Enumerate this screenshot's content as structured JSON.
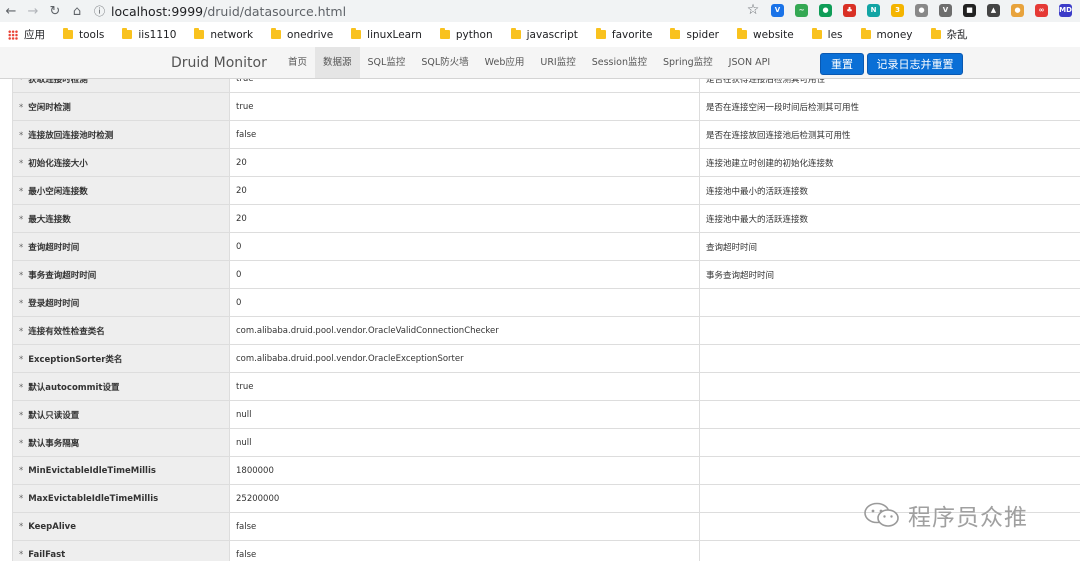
{
  "browser": {
    "url_host": "localhost:9999",
    "url_path": "/druid/datasource.html",
    "bookmarks": [
      "应用",
      "tools",
      "iis1110",
      "network",
      "onedrive",
      "linuxLearn",
      "python",
      "javascript",
      "favorite",
      "spider",
      "website",
      "les",
      "money",
      "杂乱"
    ],
    "extensions": [
      {
        "name": "v-ext-icon",
        "color": "#1a73e8",
        "label": "V"
      },
      {
        "name": "wave-ext-icon",
        "color": "#34a853",
        "label": "~"
      },
      {
        "name": "green-circle-ext-icon",
        "color": "#0f9d58",
        "label": "●"
      },
      {
        "name": "red-ext-icon",
        "color": "#d93025",
        "label": "♣"
      },
      {
        "name": "n-ext-icon",
        "color": "#12a4a4",
        "label": "N"
      },
      {
        "name": "badge-ext-icon",
        "color": "#f4b400",
        "label": "3"
      },
      {
        "name": "dot-ext-icon",
        "color": "#888888",
        "label": "●"
      },
      {
        "name": "vee-ext-icon",
        "color": "#6d6d6d",
        "label": "V"
      },
      {
        "name": "dark-ext-icon",
        "color": "#222222",
        "label": "■"
      },
      {
        "name": "hat-ext-icon",
        "color": "#444444",
        "label": "▲"
      },
      {
        "name": "cookie-ext-icon",
        "color": "#e8a33c",
        "label": "●"
      },
      {
        "name": "media-ext-icon",
        "color": "#e53935",
        "label": "∞"
      },
      {
        "name": "md-ext-icon",
        "color": "#3c3cc8",
        "label": "MD"
      }
    ]
  },
  "druid": {
    "brand": "Druid Monitor",
    "tabs": [
      "首页",
      "数据源",
      "SQL监控",
      "SQL防火墙",
      "Web应用",
      "URI监控",
      "Session监控",
      "Spring监控",
      "JSON API"
    ],
    "active_tab": 1,
    "reset_label": "重置",
    "log_reset_label": "记录日志并重置"
  },
  "rows": [
    {
      "key": "获取连接时检测",
      "val": "true",
      "desc": "是否在获得连接后检测其可用性"
    },
    {
      "key": "空闲时检测",
      "val": "true",
      "desc": "是否在连接空闲一段时间后检测其可用性"
    },
    {
      "key": "连接放回连接池时检测",
      "val": "false",
      "desc": "是否在连接放回连接池后检测其可用性"
    },
    {
      "key": "初始化连接大小",
      "val": "20",
      "desc": "连接池建立时创建的初始化连接数"
    },
    {
      "key": "最小空闲连接数",
      "val": "20",
      "desc": "连接池中最小的活跃连接数"
    },
    {
      "key": "最大连接数",
      "val": "20",
      "desc": "连接池中最大的活跃连接数"
    },
    {
      "key": "查询超时时间",
      "val": "0",
      "desc": "查询超时时间"
    },
    {
      "key": "事务查询超时时间",
      "val": "0",
      "desc": "事务查询超时时间"
    },
    {
      "key": "登录超时时间",
      "val": "0",
      "desc": ""
    },
    {
      "key": "连接有效性检查类名",
      "val": "com.alibaba.druid.pool.vendor.OracleValidConnectionChecker",
      "desc": ""
    },
    {
      "key": "ExceptionSorter类名",
      "val": "com.alibaba.druid.pool.vendor.OracleExceptionSorter",
      "desc": ""
    },
    {
      "key": "默认autocommit设置",
      "val": "true",
      "desc": ""
    },
    {
      "key": "默认只读设置",
      "val": "null",
      "desc": ""
    },
    {
      "key": "默认事务隔离",
      "val": "null",
      "desc": ""
    },
    {
      "key": "MinEvictableIdleTimeMillis",
      "val": "1800000",
      "desc": ""
    },
    {
      "key": "MaxEvictableIdleTimeMillis",
      "val": "25200000",
      "desc": ""
    },
    {
      "key": "KeepAlive",
      "val": "false",
      "desc": ""
    },
    {
      "key": "FailFast",
      "val": "false",
      "desc": ""
    }
  ],
  "row_marker": "*",
  "watermark": "程序员众推"
}
